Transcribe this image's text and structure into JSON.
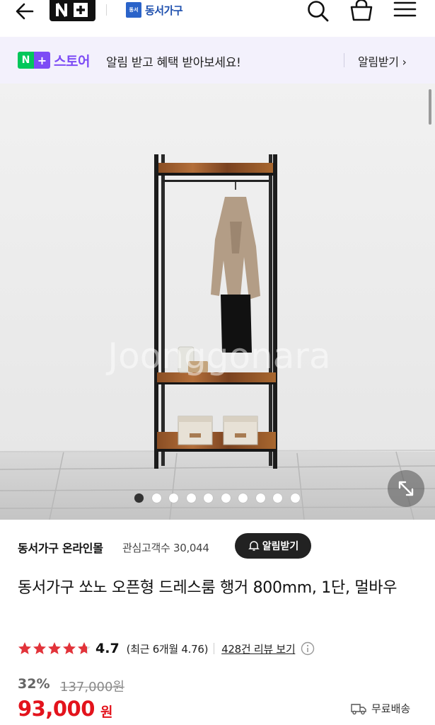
{
  "header": {
    "back_icon": "back-arrow-icon",
    "naver_plus_logo": "N+",
    "brand_logo_text": "동서",
    "brand_name": "동서가구",
    "search_icon": "search-icon",
    "cart_icon": "cart-icon",
    "menu_icon": "menu-icon"
  },
  "banner": {
    "badge_n": "N",
    "badge_plus": "+",
    "store_label": "스토어",
    "message": "알림 받고 혜택 받아보세요!",
    "button_label": "알림받기 ›"
  },
  "gallery": {
    "watermark": "Joonggonara",
    "slide_count": 10,
    "active_slide": 1,
    "expand_icon": "expand-icon"
  },
  "seller": {
    "name": "동서가구 온라인몰",
    "fans_label": "관심고객수 30,044",
    "alarm_button": "알림받기"
  },
  "product": {
    "title": "동서가구 쏘노 오픈형 드레스룸 행거 800mm, 1단, 멀바우",
    "rating": {
      "stars": 4.7,
      "score": "4.7",
      "recent": "(최근 6개월 4.76)",
      "reviews": "428건 리뷰 보기"
    },
    "discount": "32%",
    "original_price": "137,000원",
    "price": "93,000",
    "currency": "원",
    "shipping": "무료배송"
  },
  "colors": {
    "naver_green": "#03c75a",
    "store_purple": "#7d4cf5",
    "price_red": "#e3131c",
    "star_red": "#e2333a"
  }
}
